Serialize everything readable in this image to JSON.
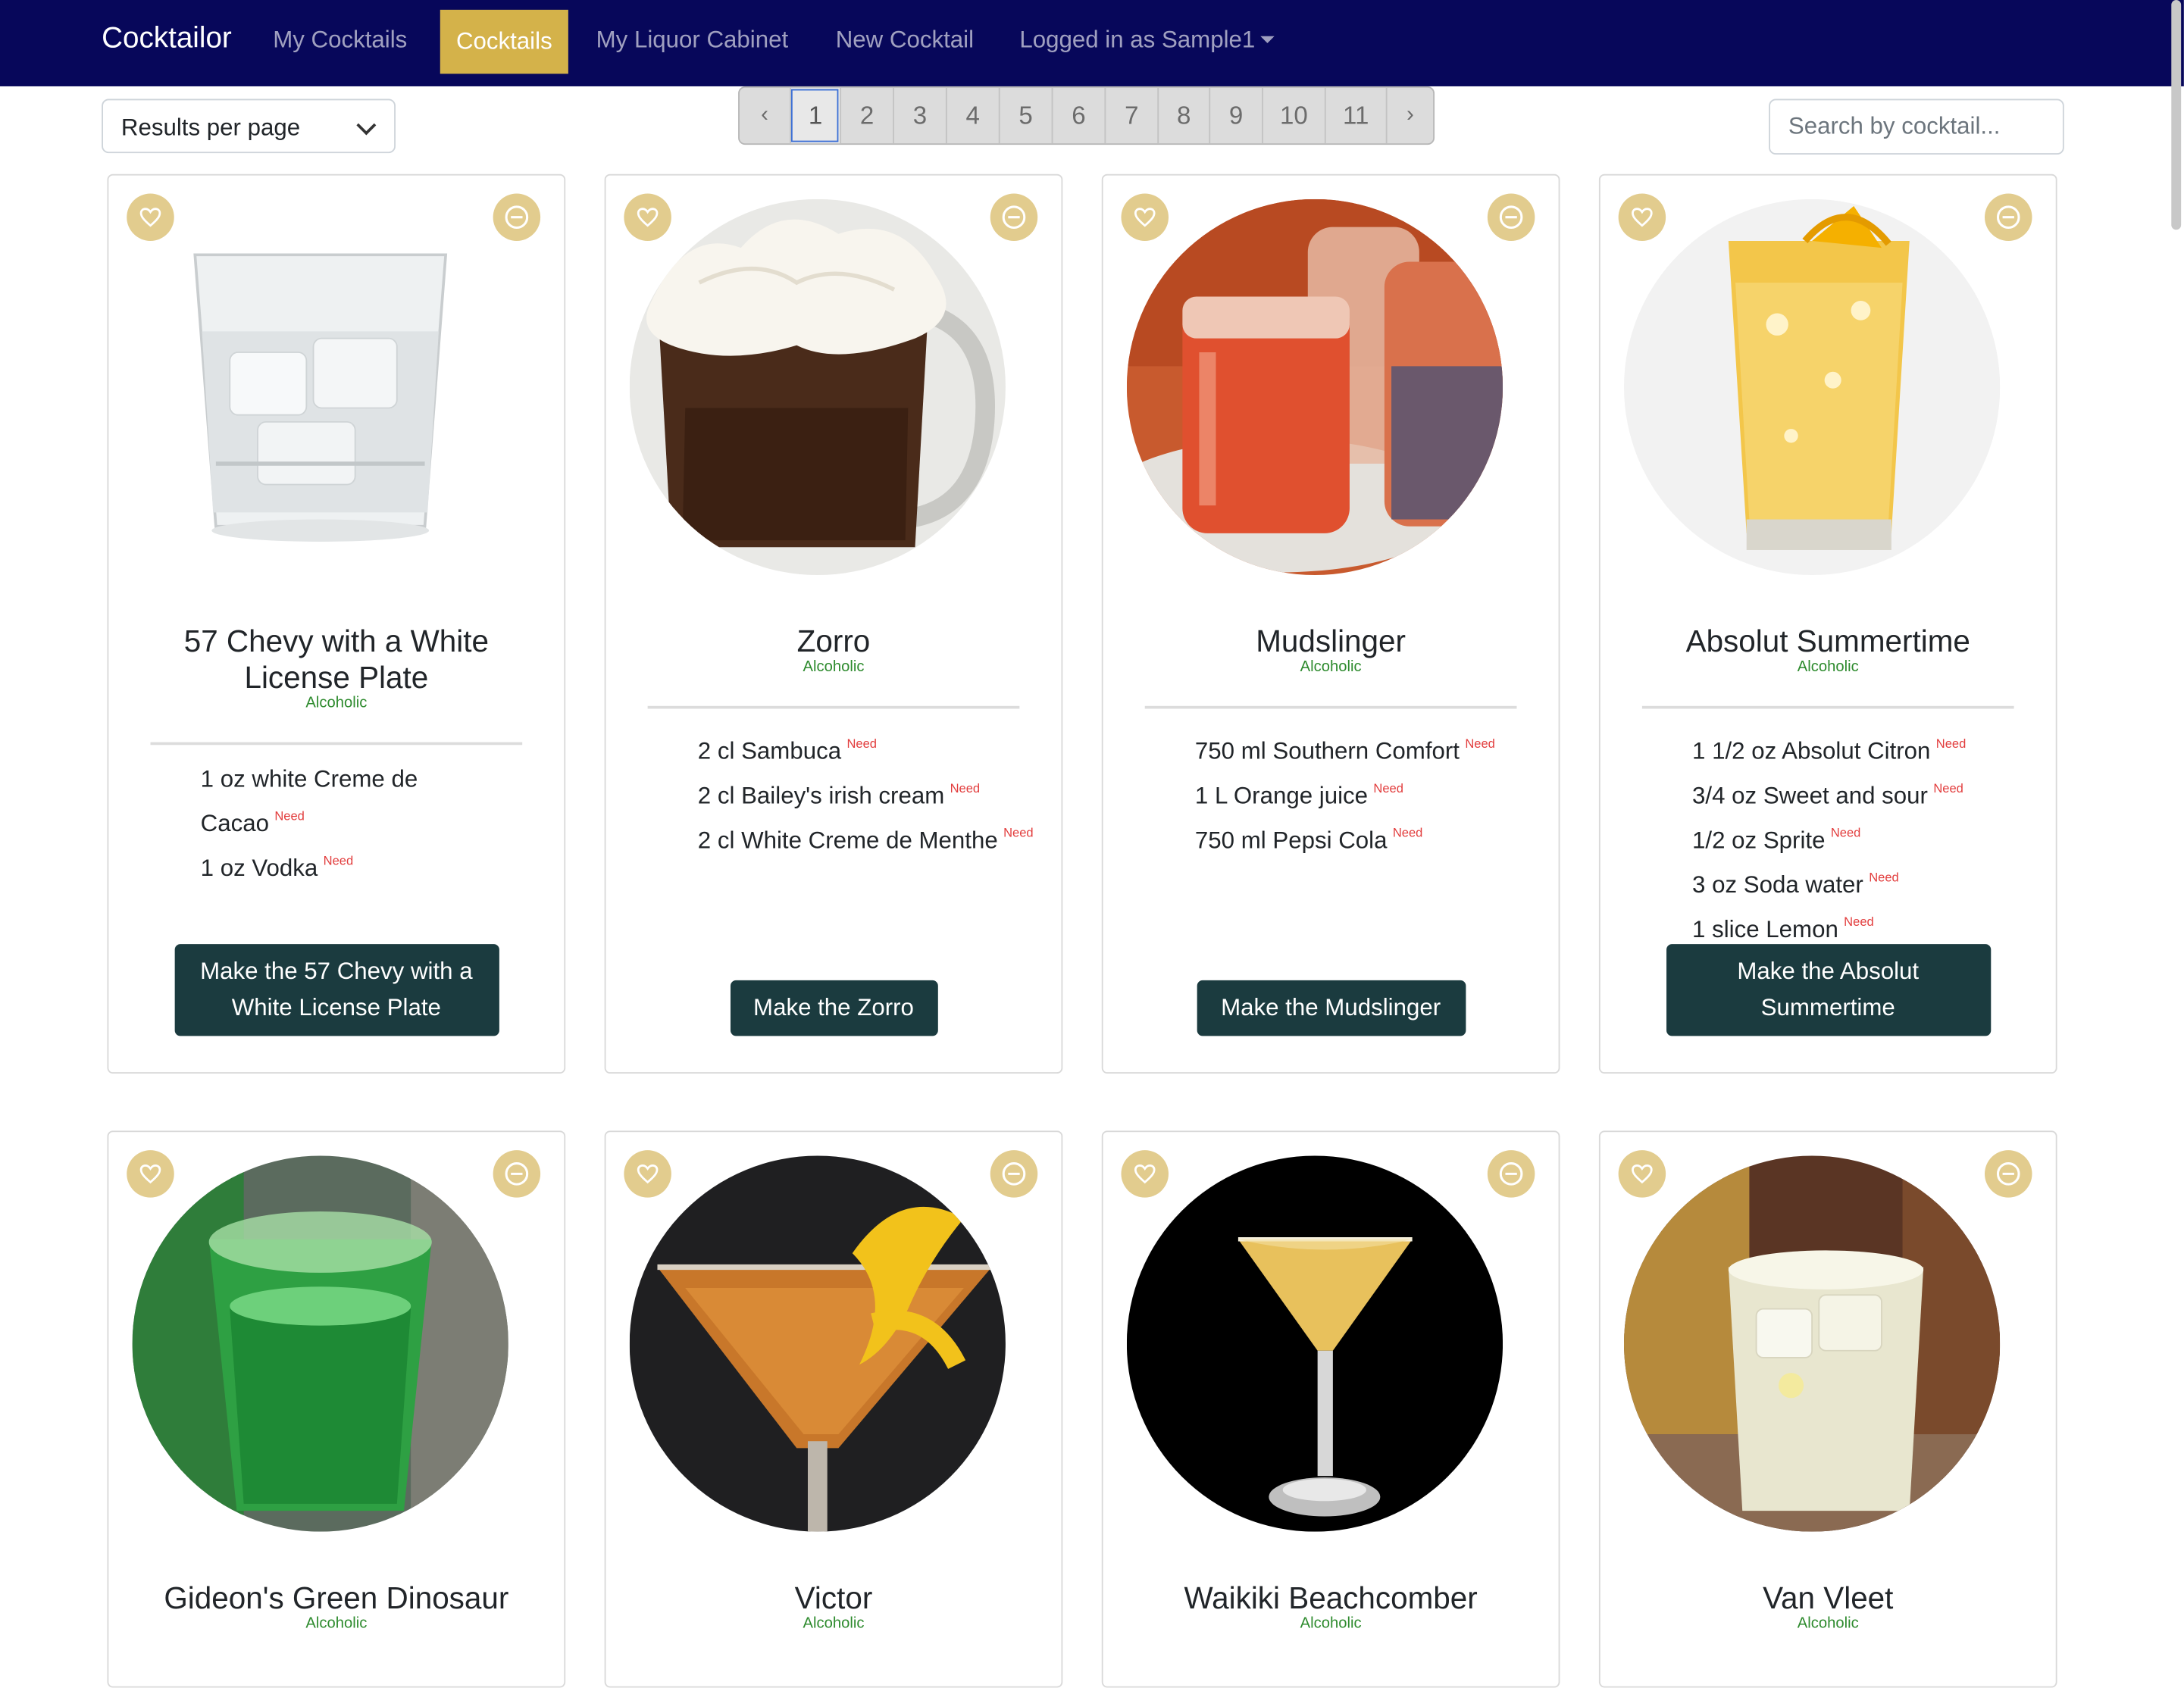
{
  "navbar": {
    "brand": "Cocktailor",
    "links": [
      "My Cocktails",
      "Cocktails",
      "My Liquor Cabinet",
      "New Cocktail"
    ],
    "active": "Cocktails",
    "user": "Logged in as Sample1"
  },
  "controls": {
    "results_per_page": "Results per page",
    "search_placeholder": "Search by cocktail...",
    "pagination": {
      "prev": "‹",
      "pages": [
        "1",
        "2",
        "3",
        "4",
        "5",
        "6",
        "7",
        "8",
        "9",
        "10",
        "11"
      ],
      "current": "1",
      "next": "›"
    }
  },
  "need_label": "Need",
  "cards": [
    {
      "title": "57 Chevy with a White License Plate",
      "title_lines": [
        "57 Chevy with a White",
        "License Plate"
      ],
      "type": "Alcoholic",
      "ingredients": [
        "1 oz white Creme de Cacao",
        "1 oz Vodka"
      ],
      "button": "Make the 57 Chevy with a White License Plate",
      "button_lines": [
        "Make the 57 Chevy with a",
        "White License Plate"
      ]
    },
    {
      "title": "Zorro",
      "type": "Alcoholic",
      "ingredients": [
        "2 cl Sambuca",
        "2 cl Bailey's irish cream",
        "2 cl White Creme de Menthe"
      ],
      "button": "Make the Zorro"
    },
    {
      "title": "Mudslinger",
      "type": "Alcoholic",
      "ingredients": [
        "750 ml Southern Comfort",
        "1 L Orange juice",
        "750 ml Pepsi Cola"
      ],
      "button": "Make the Mudslinger"
    },
    {
      "title": "Absolut Summertime",
      "type": "Alcoholic",
      "ingredients": [
        "1 1/2 oz Absolut Citron",
        "3/4 oz Sweet and sour",
        "1/2 oz Sprite",
        "3 oz Soda water",
        "1 slice Lemon"
      ],
      "button": "Make the Absolut Summertime",
      "button_lines": [
        "Make the Absolut",
        "Summertime"
      ]
    },
    {
      "title": "Gideon's Green Dinosaur",
      "type": "Alcoholic"
    },
    {
      "title": "Victor",
      "type": "Alcoholic"
    },
    {
      "title": "Waikiki Beachcomber",
      "type": "Alcoholic"
    },
    {
      "title": "Van Vleet",
      "type": "Alcoholic"
    }
  ],
  "icons": {
    "favorite": "heart-icon",
    "remove": "minus-circle-icon",
    "dropdown": "chevron-down-icon",
    "user_menu": "caret-down-icon"
  },
  "colors": {
    "navbar": "#07075a",
    "active_tab": "#d4b24a",
    "icon_button": "#e2cc8e",
    "make_button": "#1b3b3f",
    "alcoholic_label": "#2e8b2e",
    "need_label": "#e23d3d"
  }
}
